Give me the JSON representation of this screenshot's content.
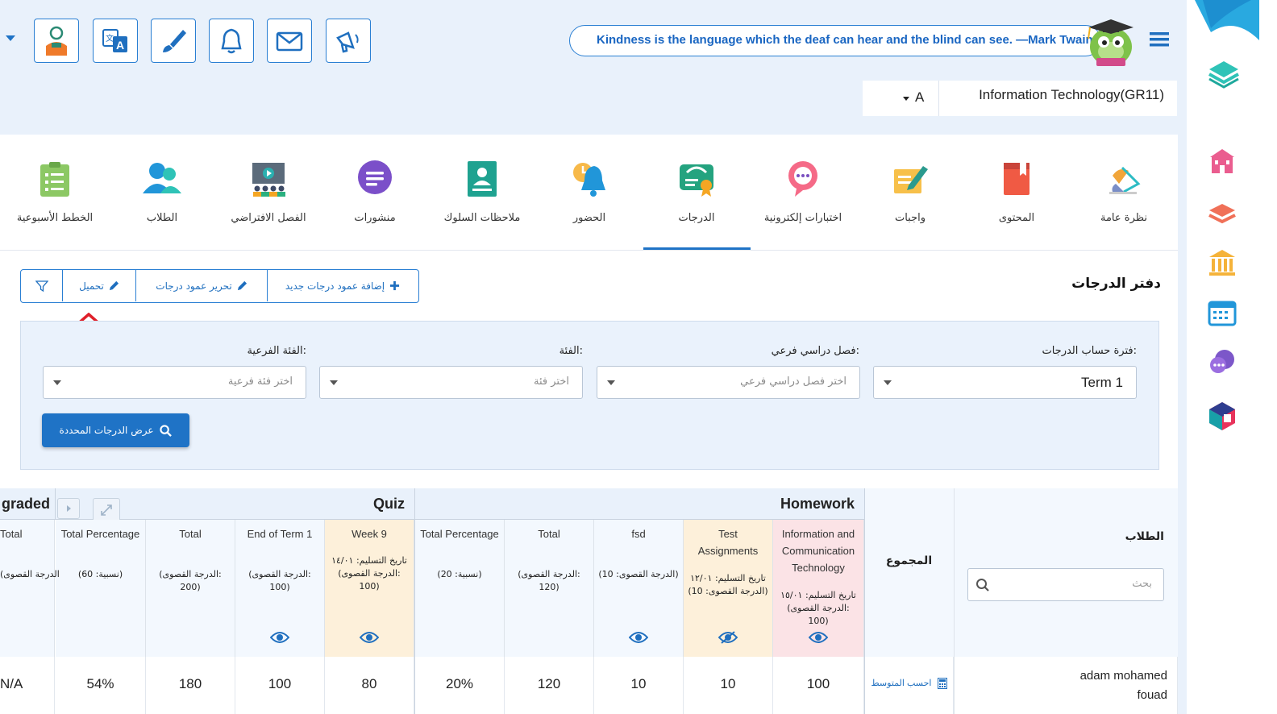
{
  "quote": "Kindness is the language which the deaf can hear and the blind can see. —Mark Twain",
  "course": {
    "name": "Information Technology(GR11)",
    "class": "A"
  },
  "toolbar": {
    "buttons": [
      "profile-icon",
      "translate-icon",
      "brush-icon",
      "bell-icon",
      "mail-icon",
      "megaphone-icon"
    ]
  },
  "tabs": [
    {
      "label": "نظرة عامة",
      "icon": "overview-icon"
    },
    {
      "label": "المحتوى",
      "icon": "book-icon"
    },
    {
      "label": "واجبات",
      "icon": "assignment-icon"
    },
    {
      "label": "اختبارات إلكترونية",
      "icon": "quiz-icon"
    },
    {
      "label": "الدرجات",
      "icon": "grades-icon",
      "active": true
    },
    {
      "label": "الحضور",
      "icon": "attendance-icon"
    },
    {
      "label": "ملاحظات السلوك",
      "icon": "behavior-icon"
    },
    {
      "label": "منشورات",
      "icon": "posts-icon"
    },
    {
      "label": "الفصل الافتراضي",
      "icon": "virtual-class-icon"
    },
    {
      "label": "الطلاب",
      "icon": "students-icon"
    },
    {
      "label": "الخطط الأسبوعية",
      "icon": "weekly-plans-icon"
    }
  ],
  "gradebook": {
    "title": "دفتر الدرجات",
    "actions": {
      "add_column": "إضافة عمود درجات جديد",
      "edit_column": "تحرير عمود درجات",
      "upload": "تحميل"
    }
  },
  "filters": {
    "period_label": "فترة حساب الدرجات:",
    "period_value": "Term 1",
    "subterm_label": "فصل دراسي فرعي:",
    "subterm_placeholder": "اختر فصل دراسي فرعي",
    "category_label": "الفئة:",
    "category_placeholder": "اختر فئة",
    "subcategory_label": "الفئة الفرعية:",
    "subcategory_placeholder": "اختر فئة فرعية",
    "show_button": "عرض الدرجات المحددة"
  },
  "table": {
    "students_header": "الطلاب",
    "search_placeholder": "بحث",
    "total_header": "المجموع",
    "groups": [
      "Homework",
      "Quiz",
      "graded"
    ],
    "columns": [
      {
        "name": "Information and Communication Technology",
        "sub": "تاريخ التسليم: ١٥/٠١\n(الدرجة القصوى:\n100)",
        "value": "100"
      },
      {
        "name": "Test Assignments",
        "sub": "تاريخ التسليم: ١٢/٠١\n(الدرجة القصوى: 10)",
        "value": "10"
      },
      {
        "name": "fsd",
        "sub": "(الدرجة القصوى: 10)",
        "value": "10"
      },
      {
        "name": "Total",
        "sub": "(الدرجة القصوى:\n120)",
        "value": "120"
      },
      {
        "name": "Total Percentage",
        "sub": "(نسبية: 20)",
        "value": "20%"
      },
      {
        "name": "Week 9",
        "sub": "تاريخ التسليم: ١٤/٠١\n(الدرجة القصوى:\n100)",
        "value": "80"
      },
      {
        "name": "End of Term 1",
        "sub": "(الدرجة القصوى:\n100)",
        "value": "100"
      },
      {
        "name": "Total",
        "sub": "(الدرجة القصوى:\n200)",
        "value": "180"
      },
      {
        "name": "Total Percentage",
        "sub": "(نسبية: 60)",
        "value": "54%"
      },
      {
        "name": "Total",
        "sub": "(الدرجة القصوى",
        "value": "N/A"
      }
    ],
    "student": {
      "name": "adam mohamed fouad",
      "calc_average": "احسب المتوسط"
    }
  },
  "colors": {
    "accent": "#1f73c6",
    "highlight_yellow": "#fdf0da",
    "highlight_pink": "#fbe3e6"
  }
}
